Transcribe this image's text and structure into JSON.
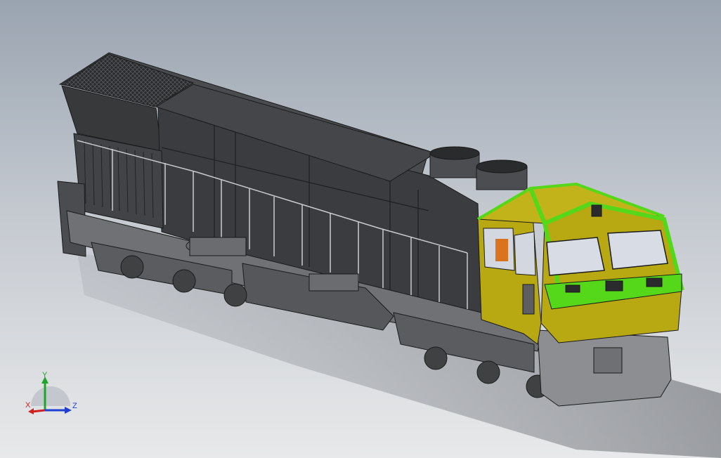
{
  "triad": {
    "x_label": "X",
    "y_label": "Y",
    "z_label": "Z"
  },
  "colors": {
    "body": "#3c3e40",
    "body_dark": "#2b2c2e",
    "cab": "#b9aa10",
    "cab_trim": "#55d81a",
    "under": "#6d6f72",
    "glass": "#cfd6e2",
    "axis_x": "#d21f1f",
    "axis_y": "#1fa52a",
    "axis_z": "#1f3fd2"
  }
}
